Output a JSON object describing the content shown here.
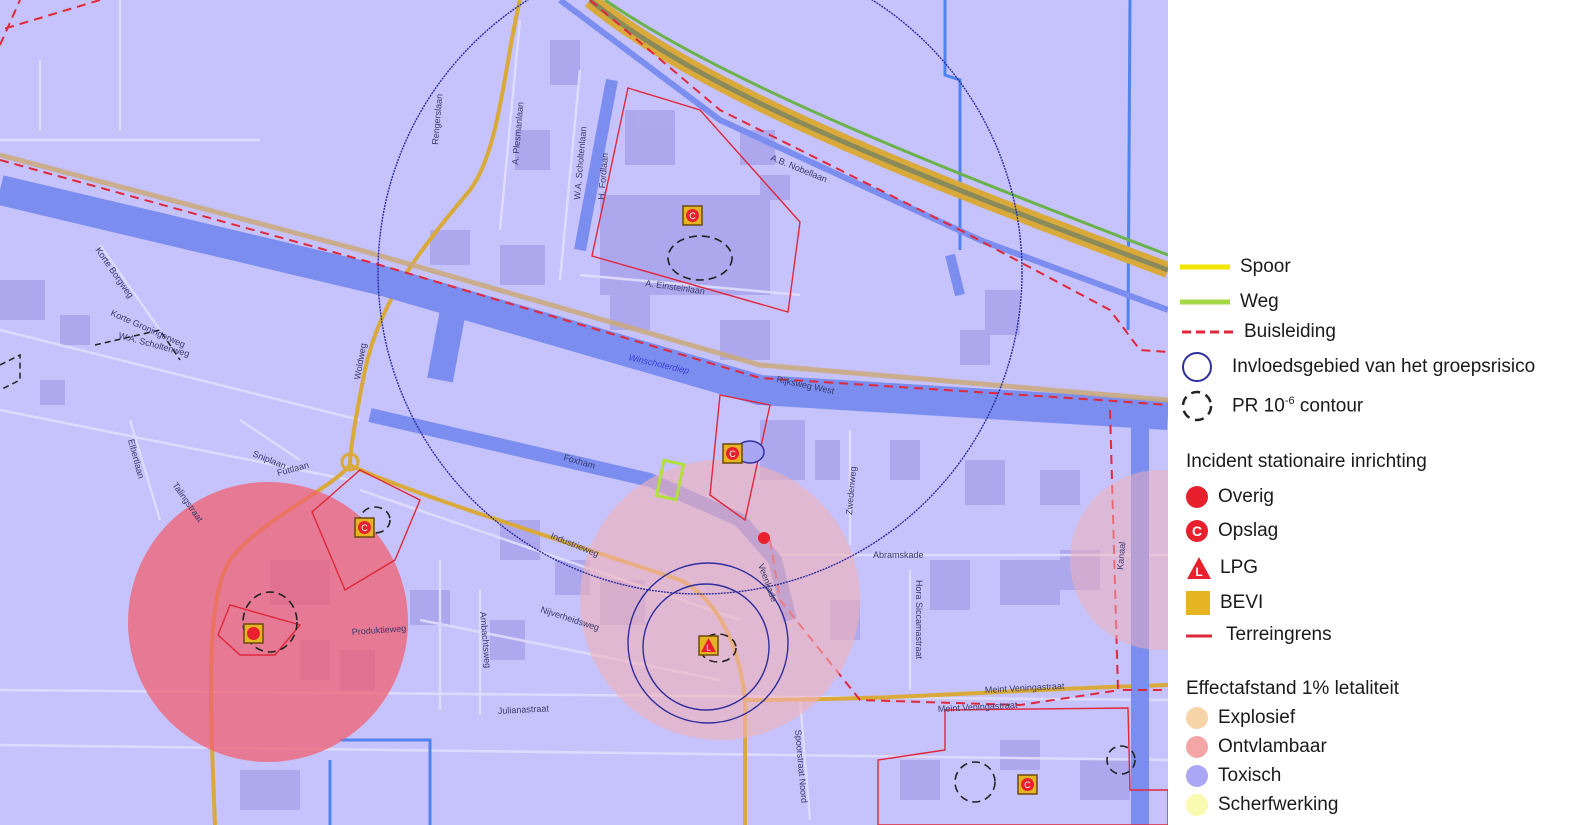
{
  "legend": {
    "spoor": "Spoor",
    "weg": "Weg",
    "buisleiding": "Buisleiding",
    "invloedsgebied": "Invloedsgebied van het groepsrisico",
    "pr_prefix": "PR 10",
    "pr_exp": "-6",
    "pr_suffix": " contour",
    "incident_title": "Incident stationaire inrichting",
    "overig": "Overig",
    "opslag": "Opslag",
    "lpg": "LPG",
    "bevi": "BEVI",
    "terreingrens": "Terreingrens",
    "effect_title": "Effectafstand 1% letaliteit",
    "explosief": "Explosief",
    "ontvlambaar": "Ontvlambaar",
    "toxisch": "Toxisch",
    "scherfwerking": "Scherfwerking"
  },
  "colors": {
    "spoor": "#f2e600",
    "weg": "#a6d94a",
    "buisleiding": "#e0283a",
    "invloedsgebied": "#2e2e9e",
    "pr_contour": "#222222",
    "overig": "#e8202e",
    "opslag": "#e8202e",
    "lpg": "#e8202e",
    "bevi": "#e6b422",
    "terreingrens": "#e0283a",
    "explosief": "#f7d3a8",
    "ontvlambaar": "#f4a5a5",
    "toxisch": "#aaa8f5",
    "scherfwerking": "#fafab0"
  },
  "map": {
    "streets": {
      "rengerslaan": "Rengerslaan",
      "plesmanlaan": "A. Plesmanlaan",
      "scholtenlaan": "W.A. Scholtenlaan",
      "fordlaan": "H. Fordlaan",
      "nobellaan": "A.B. Nobellaan",
      "einsteinlaan": "A. Einsteinlaan",
      "korte_borgweg": "Korte Borgweg",
      "korte_groningerweg": "Korte Groningerweg",
      "wa_scholtenweg": "W.A. Scholtenweg",
      "woldweg": "Woldweg",
      "rijksweg_west": "Rijksweg West",
      "foxham": "Foxham",
      "zwedenweg": "Zwedenweg",
      "abramskade": "Abramskade",
      "elbertlaan": "Elbertlaan",
      "sniplaan": "Sniplaan",
      "futtlaan": "Futtlaan",
      "talingstraat": "Talingstraat",
      "industrieweg": "Industrieweg",
      "produktieweg": "Produktieweg",
      "ambachtsweg": "Ambachtsweg",
      "nijverheidsweg": "Nijverheidsweg",
      "julianastraat": "Julianastraat",
      "veenkade": "Veenkade",
      "hora_siccamastraat": "Hora Siccamastraat",
      "meint_veningastraat_1": "Meint Veningastraat",
      "meint_veningastraat_2": "Meint Veningastraat",
      "spoorstraat_noord": "Spoorstraat Noord",
      "kanaal": "Kanaal"
    },
    "water": {
      "winschoterdiep": "Winschoterdiep"
    },
    "opslag_letter": "C",
    "lpg_letter": "L"
  }
}
